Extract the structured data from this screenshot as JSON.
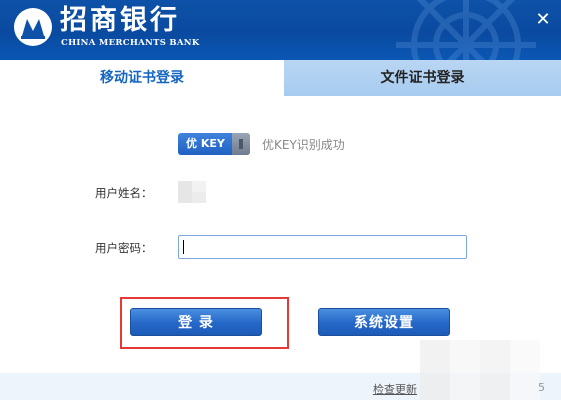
{
  "header": {
    "bank_name_cn": "招商银行",
    "bank_name_en": "CHINA MERCHANTS BANK",
    "close_icon": "close-icon",
    "brand_color": "#0d52a8"
  },
  "tabs": [
    {
      "label": "移动证书登录",
      "active": true
    },
    {
      "label": "文件证书登录",
      "active": false
    }
  ],
  "key_status": {
    "badge_label": "优 KEY",
    "message": "优KEY识别成功"
  },
  "form": {
    "username_label": "用户姓名：",
    "password_label": "用户密码：",
    "password_value": "",
    "password_placeholder": ""
  },
  "buttons": {
    "login_label": "登 录",
    "settings_label": "系统设置"
  },
  "footer": {
    "update_link": "检查更新",
    "version_fragment": "5"
  },
  "accent_colors": {
    "tab_active_text": "#1565c0",
    "highlight": "#e53935"
  }
}
